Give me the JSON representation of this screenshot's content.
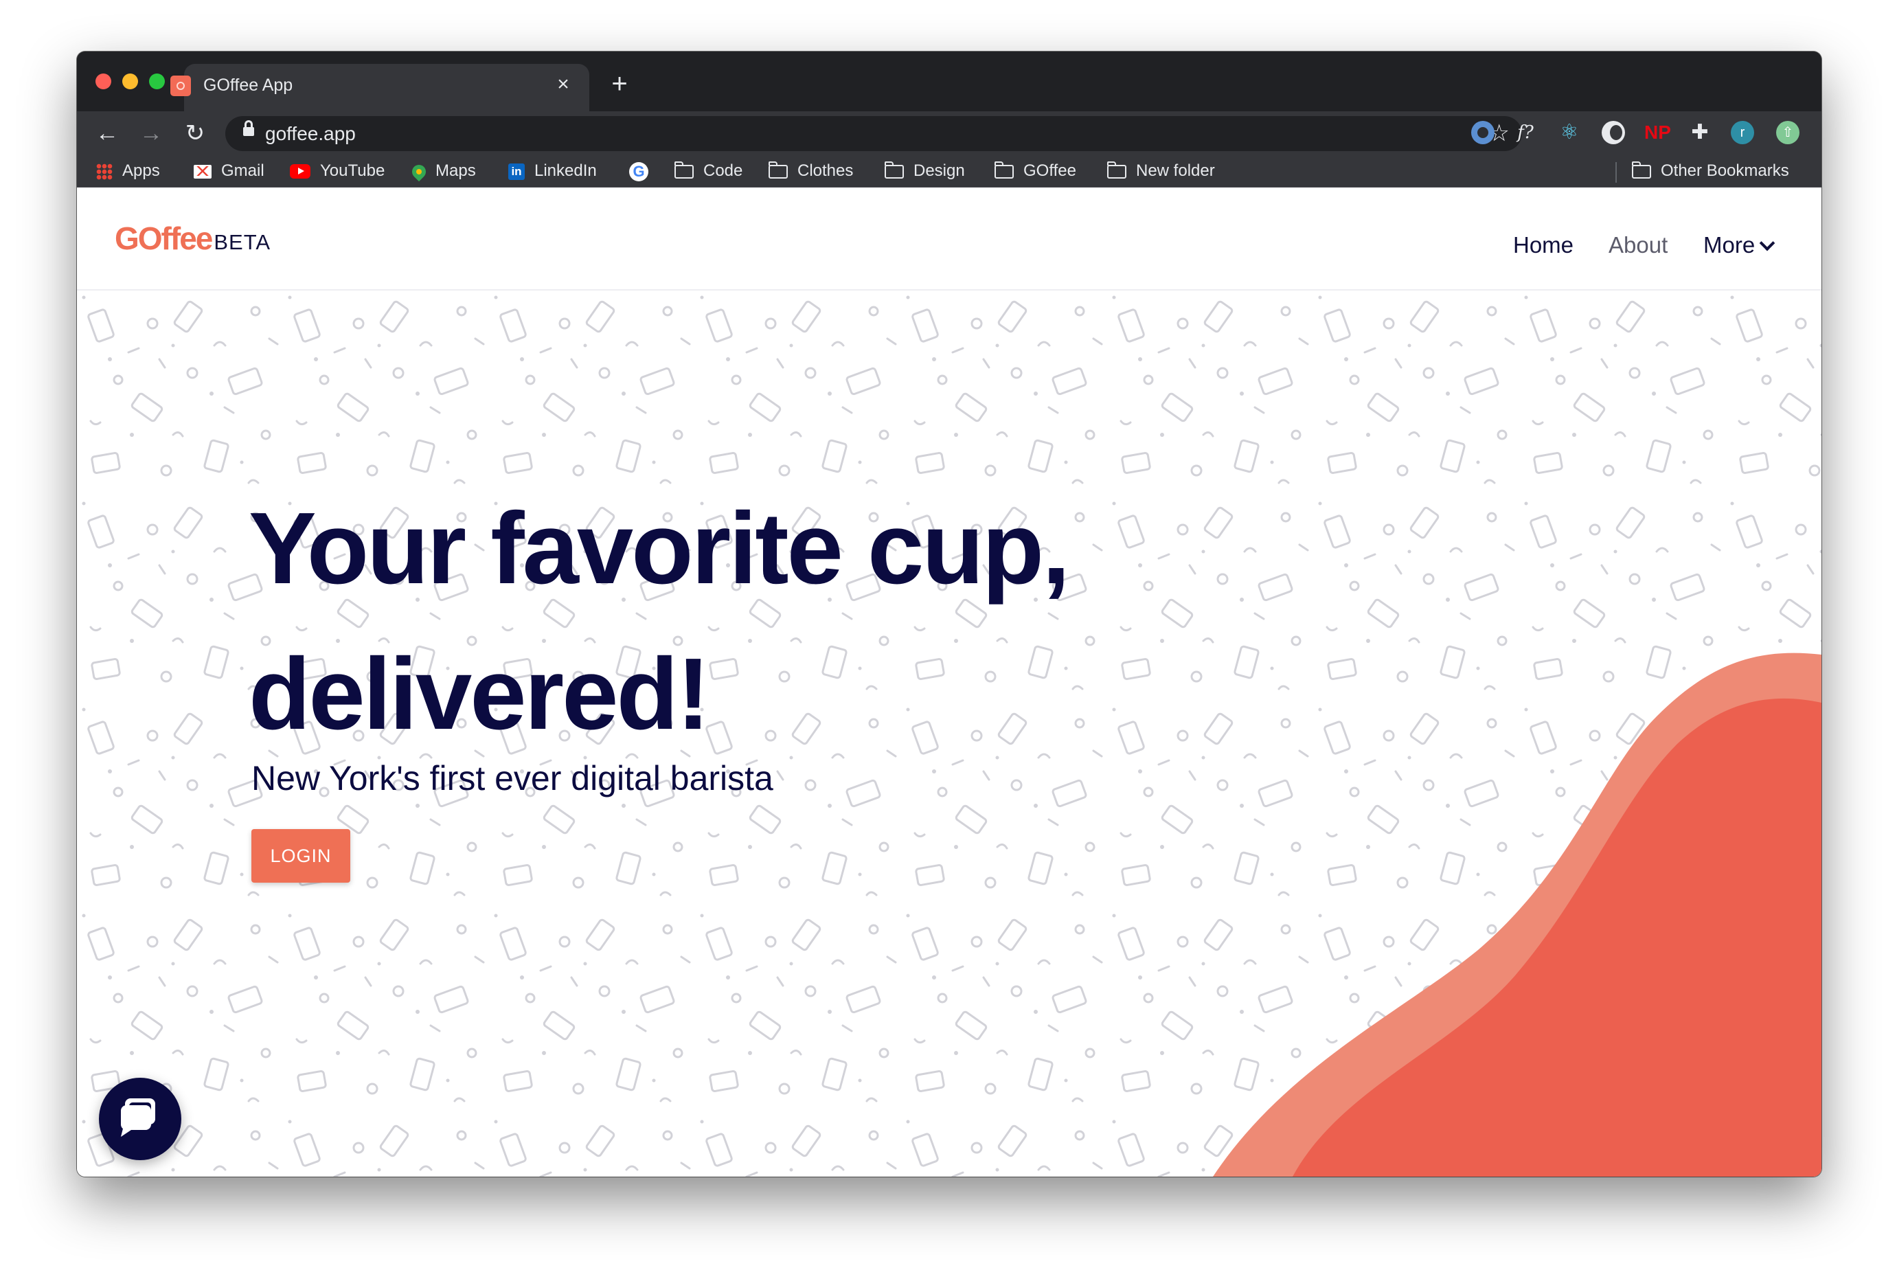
{
  "browser": {
    "tab_title": "GOffee App",
    "tab_close": "×",
    "new_tab": "+",
    "nav": {
      "back": "←",
      "forward": "→",
      "reload": "↻"
    },
    "url": "goffee.app",
    "star": "☆",
    "extensions": [
      "f?",
      "⚛",
      "NP",
      "✚",
      "r",
      "⇧"
    ],
    "bookmarks": [
      {
        "label": "Apps",
        "icon": "apps-grid-icon"
      },
      {
        "label": "Gmail",
        "icon": "gmail-icon"
      },
      {
        "label": "YouTube",
        "icon": "youtube-icon"
      },
      {
        "label": "Maps",
        "icon": "maps-icon"
      },
      {
        "label": "LinkedIn",
        "icon": "linkedin-icon"
      },
      {
        "label": "",
        "icon": "google-icon"
      },
      {
        "label": "Code",
        "icon": "folder-icon"
      },
      {
        "label": "Clothes",
        "icon": "folder-icon"
      },
      {
        "label": "Design",
        "icon": "folder-icon"
      },
      {
        "label": "GOffee",
        "icon": "folder-icon"
      },
      {
        "label": "New folder",
        "icon": "folder-icon"
      }
    ],
    "other_bookmarks": "Other Bookmarks"
  },
  "site": {
    "logo": "GOffee",
    "logo_badge": "BETA",
    "nav": {
      "home": "Home",
      "about": "About",
      "more": "More"
    },
    "headline_line1": "Your favorite cup,",
    "headline_line2": "delivered!",
    "subheadline": "New York's first ever digital barista",
    "login_button": "LOGIN",
    "colors": {
      "brand": "#ef7055",
      "navy": "#0b0b40",
      "blob_light": "#ee8a75",
      "blob_dark": "#ec604f"
    }
  }
}
